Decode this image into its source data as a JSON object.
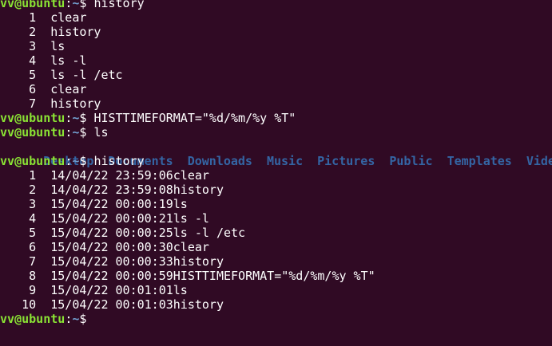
{
  "prompt": {
    "user": "avv@ubuntu",
    "sep": ":",
    "path": "~",
    "dollar": "$ "
  },
  "history1": [
    {
      "n": "1",
      "cmd": "clear"
    },
    {
      "n": "2",
      "cmd": "history"
    },
    {
      "n": "3",
      "cmd": "ls"
    },
    {
      "n": "4",
      "cmd": "ls -l"
    },
    {
      "n": "5",
      "cmd": "ls -l /etc"
    },
    {
      "n": "6",
      "cmd": "clear"
    },
    {
      "n": "7",
      "cmd": "history"
    }
  ],
  "commands": {
    "top": "history",
    "export": "HISTTIMEFORMAT=\"%d/%m/%y %T\"",
    "ls": "ls",
    "history": "history"
  },
  "ls_output": [
    "Desktop",
    "Documents",
    "Downloads",
    "Music",
    "Pictures",
    "Public",
    "Templates",
    "Videos"
  ],
  "history2": [
    {
      "n": "1",
      "entry": "14/04/22 23:59:06clear"
    },
    {
      "n": "2",
      "entry": "14/04/22 23:59:08history"
    },
    {
      "n": "3",
      "entry": "15/04/22 00:00:19ls"
    },
    {
      "n": "4",
      "entry": "15/04/22 00:00:21ls -l"
    },
    {
      "n": "5",
      "entry": "15/04/22 00:00:25ls -l /etc"
    },
    {
      "n": "6",
      "entry": "15/04/22 00:00:30clear"
    },
    {
      "n": "7",
      "entry": "15/04/22 00:00:33history"
    },
    {
      "n": "8",
      "entry": "15/04/22 00:00:59HISTTIMEFORMAT=\"%d/%m/%y %T\""
    },
    {
      "n": "9",
      "entry": "15/04/22 00:01:01ls"
    },
    {
      "n": "10",
      "entry": "15/04/22 00:01:03history"
    }
  ],
  "colors": {
    "background": "#300a24",
    "prompt_user": "#8ae234",
    "prompt_path": "#729fcf",
    "directory": "#3465a4",
    "text": "#ffffff"
  }
}
